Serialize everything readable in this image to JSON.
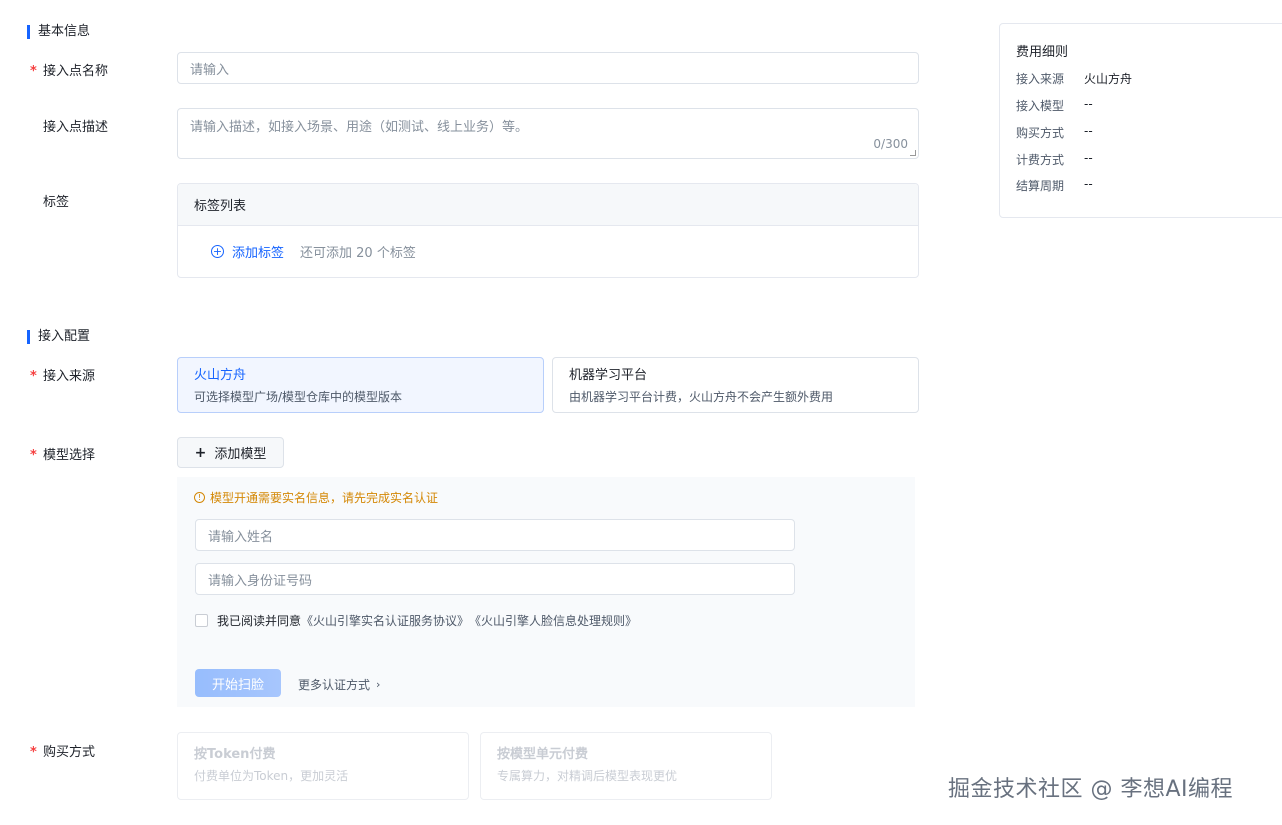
{
  "basic": {
    "section_title": "基本信息",
    "name": {
      "label": "接入点名称",
      "placeholder": "请输入"
    },
    "desc": {
      "label": "接入点描述",
      "placeholder": "请输入描述，如接入场景、用途（如测试、线上业务）等。",
      "count": "0/300"
    },
    "tags": {
      "label": "标签",
      "list_title": "标签列表",
      "add_label": "添加标签",
      "hint": "还可添加 20 个标签"
    }
  },
  "config": {
    "section_title": "接入配置",
    "source": {
      "label": "接入来源",
      "options": [
        {
          "title": "火山方舟",
          "desc": "可选择模型广场/模型仓库中的模型版本",
          "selected": true
        },
        {
          "title": "机器学习平台",
          "desc": "由机器学习平台计费，火山方舟不会产生额外费用",
          "selected": false
        }
      ]
    },
    "model": {
      "label": "模型选择",
      "add_button": "添加模型",
      "warning": "模型开通需要实名信息，请先完成实名认证",
      "name_placeholder": "请输入姓名",
      "id_placeholder": "请输入身份证号码",
      "agree_prefix": "我已阅读并同意",
      "agree_link1": "《火山引擎实名认证服务协议》",
      "agree_link2": "《火山引擎人脸信息处理规则》",
      "scan_button": "开始扫脸",
      "more_methods": "更多认证方式"
    },
    "purchase": {
      "label": "购买方式",
      "options": [
        {
          "title": "按Token付费",
          "desc": "付费单位为Token，更加灵活"
        },
        {
          "title": "按模型单元付费",
          "desc": "专属算力，对精调后模型表现更优"
        }
      ]
    }
  },
  "fee": {
    "title": "费用细则",
    "rows": [
      {
        "k": "接入来源",
        "v": "火山方舟"
      },
      {
        "k": "接入模型",
        "v": "--"
      },
      {
        "k": "购买方式",
        "v": "--"
      },
      {
        "k": "计费方式",
        "v": "--"
      },
      {
        "k": "结算周期",
        "v": "--"
      }
    ]
  },
  "watermark": "掘金技术社区 @ 李想AI编程",
  "colors": {
    "primary": "#1664ff",
    "required": "#f53f3f",
    "warning": "#d48806"
  }
}
